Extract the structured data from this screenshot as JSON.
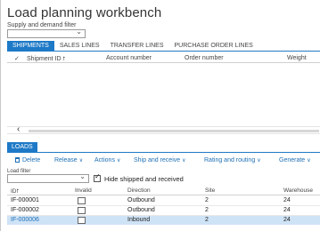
{
  "page": {
    "title": "Load planning workbench",
    "supply_filter_label": "Supply and demand filter"
  },
  "top_tabs": [
    {
      "label": "SHIPMENTS",
      "active": true
    },
    {
      "label": "SALES LINES",
      "active": false
    },
    {
      "label": "TRANSFER LINES",
      "active": false
    },
    {
      "label": "PURCHASE ORDER LINES",
      "active": false
    }
  ],
  "shipments_grid": {
    "columns": [
      "Shipment ID",
      "Account number",
      "Order number",
      "Weight"
    ]
  },
  "loads": {
    "tab_label": "LOADS",
    "toolbar": {
      "delete": "Delete",
      "release": "Release",
      "actions": "Actions",
      "ship_receive": "Ship and receive",
      "rating_routing": "Rating and routing",
      "generate": "Generate"
    },
    "load_filter_label": "Load filter",
    "hide_shipped_label": "Hide shipped and received",
    "hide_shipped_checked": true,
    "columns": [
      "ID",
      "Invalid",
      "Direction",
      "Site",
      "Warehouse"
    ],
    "rows": [
      {
        "id": "IF-000001",
        "invalid": false,
        "direction": "Outbound",
        "site": "2",
        "warehouse": "24",
        "selected": false
      },
      {
        "id": "IF-000002",
        "invalid": false,
        "direction": "Outbound",
        "site": "2",
        "warehouse": "24",
        "selected": false
      },
      {
        "id": "IF-000006",
        "invalid": false,
        "direction": "Inbound",
        "site": "2",
        "warehouse": "24",
        "selected": true
      }
    ]
  },
  "colors": {
    "accent": "#1e7ac7",
    "selected_row": "#cfe3f6"
  }
}
